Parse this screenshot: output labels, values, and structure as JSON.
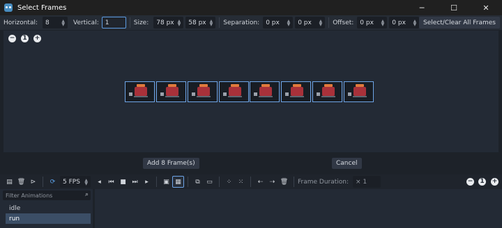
{
  "window": {
    "title": "Select Frames",
    "minimize_glyph": "─",
    "maximize_glyph": "☐",
    "close_glyph": "✕"
  },
  "settings": {
    "horizontal_label": "Horizontal:",
    "horizontal_value": "8",
    "vertical_label": "Vertical:",
    "vertical_value": "1",
    "size_label": "Size:",
    "size_x": "78 px",
    "size_y": "58 px",
    "separation_label": "Separation:",
    "separation_x": "0 px",
    "separation_y": "0 px",
    "offset_label": "Offset:",
    "offset_x": "0 px",
    "offset_y": "0 px",
    "select_clear_label": "Select/Clear All Frames"
  },
  "zoom": {
    "zoom_out": "−",
    "zoom_reset": "1",
    "zoom_in": "+"
  },
  "frames_count": 8,
  "footer": {
    "add_frames_label": "Add 8 Frame(s)",
    "cancel_label": "Cancel"
  },
  "animation_toolbar": {
    "fps_value": "5 FPS",
    "frame_duration_label": "Frame Duration:",
    "frame_duration_value": "× 1"
  },
  "animations": {
    "filter_placeholder": "Filter Animations",
    "items": [
      {
        "label": "idle",
        "selected": false
      },
      {
        "label": "run",
        "selected": true
      }
    ]
  },
  "colors": {
    "accent": "#6ea5e8",
    "selected_row": "#3b4e66"
  }
}
